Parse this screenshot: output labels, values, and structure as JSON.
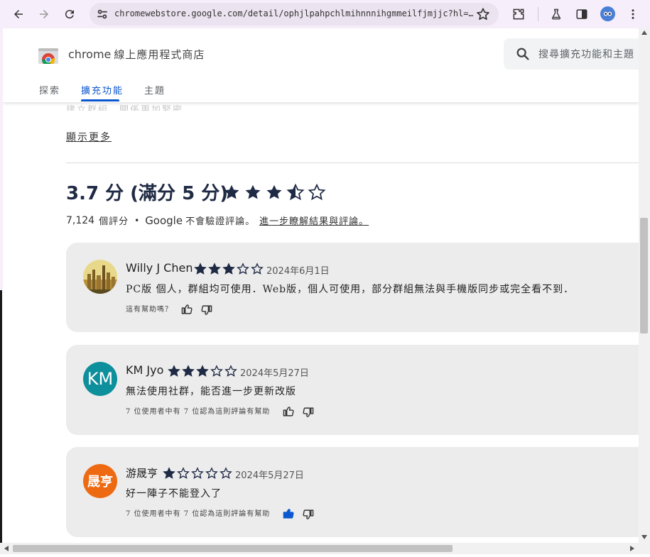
{
  "browser": {
    "url": "chromewebstore.google.com/detail/ophjlpahpchlmihnnnihgmmeilfjmjjc?hl=…",
    "icons": [
      "back-icon",
      "forward-icon",
      "reload-icon",
      "site-info-icon",
      "bookmark-star-icon",
      "extensions-icon",
      "labs-flask-icon",
      "side-panel-icon",
      "profile-avatar",
      "menu-icon"
    ]
  },
  "store": {
    "brand": "chrome",
    "brand_sub": "線上應用程式商店",
    "search_placeholder": "搜尋擴充功能和主題",
    "tabs": [
      {
        "label": "探索",
        "active": false
      },
      {
        "label": "擴充功能",
        "active": true
      },
      {
        "label": "主題",
        "active": false
      }
    ]
  },
  "main": {
    "faded_text": "建立群組，關係更加緊密",
    "show_more": "顯示更多",
    "rating_title": "3.7 分 (滿分 5 分)",
    "rating_value": 3.7,
    "rating_count": "7,124",
    "rating_count_suffix": "個評分",
    "bullet": "•",
    "google_word": "Google",
    "not_verified": "不會驗證評論。",
    "learn_more": "進一步瞭解結果與評論。"
  },
  "reviews": [
    {
      "name": "Willy J Chen",
      "stars": 3,
      "date": "2024年6月1日",
      "body": "PC版 個人，群組均可使用．Web版，個人可使用，部分群組無法與手機版同步或完全看不到．",
      "helpful": "這有幫助嗎？",
      "avatar_text": "",
      "avatar_color": "#c9b24a",
      "thumb_up_active": false
    },
    {
      "name": "KM Jyo",
      "stars": 3,
      "date": "2024年5月27日",
      "body": "無法使用社群，能否進一步更新改版",
      "helpful": "7 位使用者中有 7 位認為這則評論有幫助",
      "avatar_text": "KM",
      "avatar_color": "#0d8f9c",
      "thumb_up_active": false
    },
    {
      "name": "游晟亨",
      "stars": 1,
      "date": "2024年5月27日",
      "body": "好一陣子不能登入了",
      "helpful": "7 位使用者中有 7 位認為這則評論有幫助",
      "avatar_text": "晟亨",
      "avatar_color": "#ee6a12",
      "thumb_up_active": true
    }
  ],
  "colors": {
    "accent": "#0b57d0",
    "star": "#1f2a44",
    "card_bg": "#ececec"
  }
}
